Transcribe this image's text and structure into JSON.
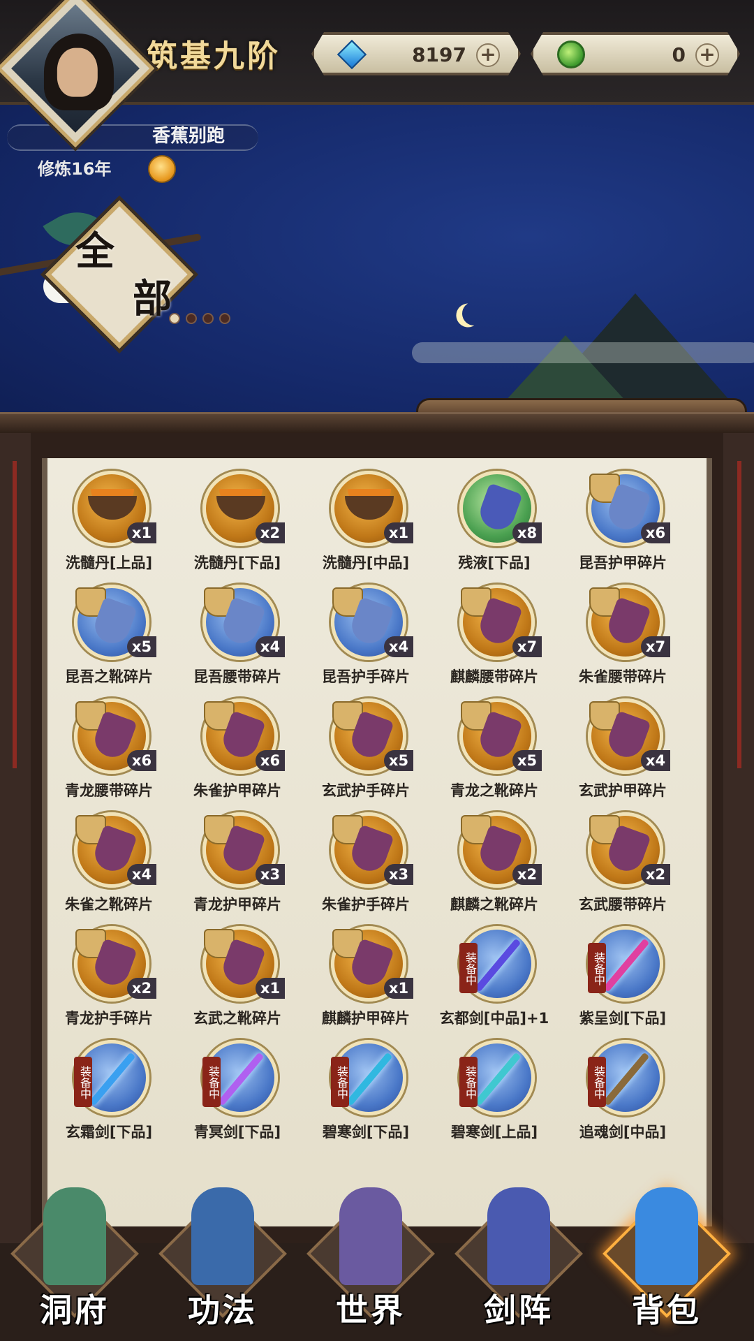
{
  "header": {
    "realm": "筑基九阶",
    "currencies": [
      {
        "name": "gem",
        "value": "8197",
        "icon": "blue-crystal-icon"
      },
      {
        "name": "jade",
        "value": "0",
        "icon": "green-jade-icon"
      }
    ],
    "plus": "+"
  },
  "profile": {
    "player_name": "香蕉别跑",
    "cultivation": "修炼16年",
    "chat": "···"
  },
  "filter": {
    "label_1": "全",
    "label_2": "部",
    "pages": 4,
    "active_page": 0
  },
  "items": [
    {
      "name": "洗髓丹[上品]",
      "count": "x1",
      "type": "gold",
      "kind": "pill"
    },
    {
      "name": "洗髓丹[下品]",
      "count": "x2",
      "type": "gold",
      "kind": "pill"
    },
    {
      "name": "洗髓丹[中品]",
      "count": "x1",
      "type": "gold",
      "kind": "pill"
    },
    {
      "name": "残液[下品]",
      "count": "x8",
      "type": "green",
      "kind": "gear"
    },
    {
      "name": "昆吾护甲碎片",
      "count": "x6",
      "type": "blue",
      "kind": "fragment"
    },
    {
      "name": "昆吾之靴碎片",
      "count": "x5",
      "type": "blue",
      "kind": "fragment"
    },
    {
      "name": "昆吾腰带碎片",
      "count": "x4",
      "type": "blue",
      "kind": "fragment"
    },
    {
      "name": "昆吾护手碎片",
      "count": "x4",
      "type": "blue",
      "kind": "fragment"
    },
    {
      "name": "麒麟腰带碎片",
      "count": "x7",
      "type": "gold",
      "kind": "fragment"
    },
    {
      "name": "朱雀腰带碎片",
      "count": "x7",
      "type": "gold",
      "kind": "fragment"
    },
    {
      "name": "青龙腰带碎片",
      "count": "x6",
      "type": "gold",
      "kind": "fragment"
    },
    {
      "name": "朱雀护甲碎片",
      "count": "x6",
      "type": "gold",
      "kind": "fragment"
    },
    {
      "name": "玄武护手碎片",
      "count": "x5",
      "type": "gold",
      "kind": "fragment"
    },
    {
      "name": "青龙之靴碎片",
      "count": "x5",
      "type": "gold",
      "kind": "fragment"
    },
    {
      "name": "玄武护甲碎片",
      "count": "x4",
      "type": "gold",
      "kind": "fragment"
    },
    {
      "name": "朱雀之靴碎片",
      "count": "x4",
      "type": "gold",
      "kind": "fragment"
    },
    {
      "name": "青龙护甲碎片",
      "count": "x3",
      "type": "gold",
      "kind": "fragment"
    },
    {
      "name": "朱雀护手碎片",
      "count": "x3",
      "type": "gold",
      "kind": "fragment"
    },
    {
      "name": "麒麟之靴碎片",
      "count": "x2",
      "type": "gold",
      "kind": "fragment"
    },
    {
      "name": "玄武腰带碎片",
      "count": "x2",
      "type": "gold",
      "kind": "fragment"
    },
    {
      "name": "青龙护手碎片",
      "count": "x2",
      "type": "gold",
      "kind": "fragment"
    },
    {
      "name": "玄武之靴碎片",
      "count": "x1",
      "type": "gold",
      "kind": "fragment"
    },
    {
      "name": "麒麟护甲碎片",
      "count": "x1",
      "type": "gold",
      "kind": "fragment"
    },
    {
      "name": "玄都剑[中品]+1",
      "equipped": "装备中",
      "type": "blue",
      "kind": "sword",
      "color": "#5a4ae0"
    },
    {
      "name": "紫呈剑[下品]",
      "equipped": "装备中",
      "type": "blue",
      "kind": "sword",
      "color": "#e040a0"
    },
    {
      "name": "玄霜剑[下品]",
      "equipped": "装备中",
      "type": "blue",
      "kind": "sword",
      "color": "#3aa0f0"
    },
    {
      "name": "青冥剑[下品]",
      "equipped": "装备中",
      "type": "blue",
      "kind": "sword",
      "color": "#b060f0"
    },
    {
      "name": "碧寒剑[下品]",
      "equipped": "装备中",
      "type": "blue",
      "kind": "sword",
      "color": "#30b8e0"
    },
    {
      "name": "碧寒剑[上品]",
      "equipped": "装备中",
      "type": "blue",
      "kind": "sword",
      "color": "#40c8d0"
    },
    {
      "name": "追魂剑[中品]",
      "equipped": "装备中",
      "type": "blue",
      "kind": "sword",
      "color": "#8a6a3a"
    }
  ],
  "nav": [
    {
      "label": "洞府",
      "icon": "cave-mansion-icon",
      "color": "#4a8a6a"
    },
    {
      "label": "功法",
      "icon": "technique-book-icon",
      "color": "#3a6aaa"
    },
    {
      "label": "世界",
      "icon": "world-scroll-icon",
      "color": "#6a5aa0"
    },
    {
      "label": "剑阵",
      "icon": "sword-array-icon",
      "color": "#4a5ab0"
    },
    {
      "label": "背包",
      "icon": "backpack-icon",
      "color": "#3a8ae0"
    }
  ]
}
